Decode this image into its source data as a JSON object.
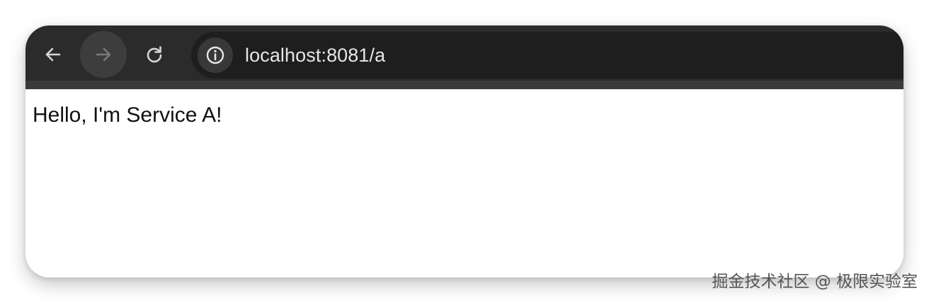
{
  "browser": {
    "toolbar": {
      "back_icon": "arrow-left-icon",
      "forward_icon": "arrow-right-icon",
      "reload_icon": "reload-icon"
    },
    "address_bar": {
      "site_info_icon": "info-circle-icon",
      "url": "localhost:8081/a"
    }
  },
  "page": {
    "body_text": "Hello, I'm Service A!"
  },
  "watermark": {
    "text": "掘金技术社区 @ 极限实验室"
  },
  "colors": {
    "toolbar_bg": "#2b2b2b",
    "omnibox_bg": "#1e1e1e",
    "icon_active": "#d6d6d6",
    "icon_disabled": "#7a7a7a",
    "page_bg": "#ffffff"
  }
}
